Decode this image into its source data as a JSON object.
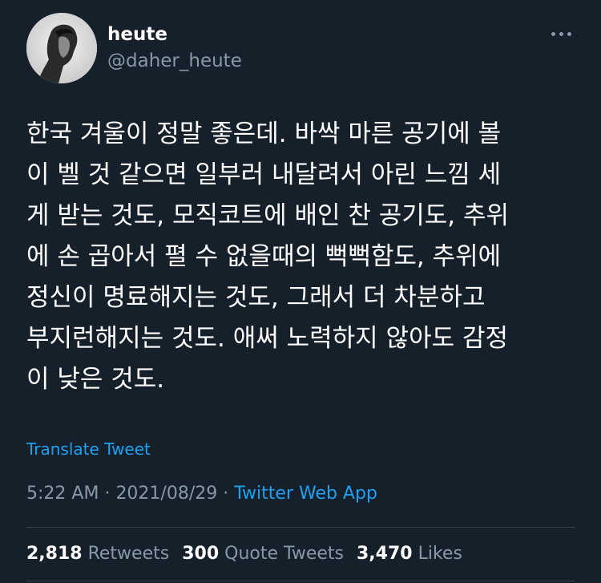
{
  "author": {
    "display_name": "heute",
    "handle": "@daher_heute"
  },
  "tweet": {
    "text": "한국 겨울이 정말 좋은데. 바싹 마른 공기에 볼\n이 벨 것 같으면 일부러 내달려서 아린 느낌 세\n게 받는 것도, 모직코트에 배인 찬 공기도, 추위\n에 손 곱아서 펼 수 없을때의 뻑뻑함도, 추위에\n정신이 명료해지는 것도, 그래서 더 차분하고\n부지런해지는 것도. 애써 노력하지 않아도 감정\n이 낮은 것도.",
    "translate_label": "Translate Tweet",
    "time": "5:22 AM",
    "separator": "·",
    "date": "2021/08/29",
    "source": "Twitter Web App"
  },
  "stats": {
    "retweets_count": "2,818",
    "retweets_label": "Retweets",
    "quotes_count": "300",
    "quotes_label": "Quote Tweets",
    "likes_count": "3,470",
    "likes_label": "Likes"
  },
  "icons": {
    "more": "more-horizontal-icon",
    "avatar": "profile-photo"
  },
  "colors": {
    "background": "#15202b",
    "text_primary": "#ffffff",
    "text_secondary": "#8899a6",
    "accent": "#1da1f2",
    "divider": "#38444d"
  }
}
